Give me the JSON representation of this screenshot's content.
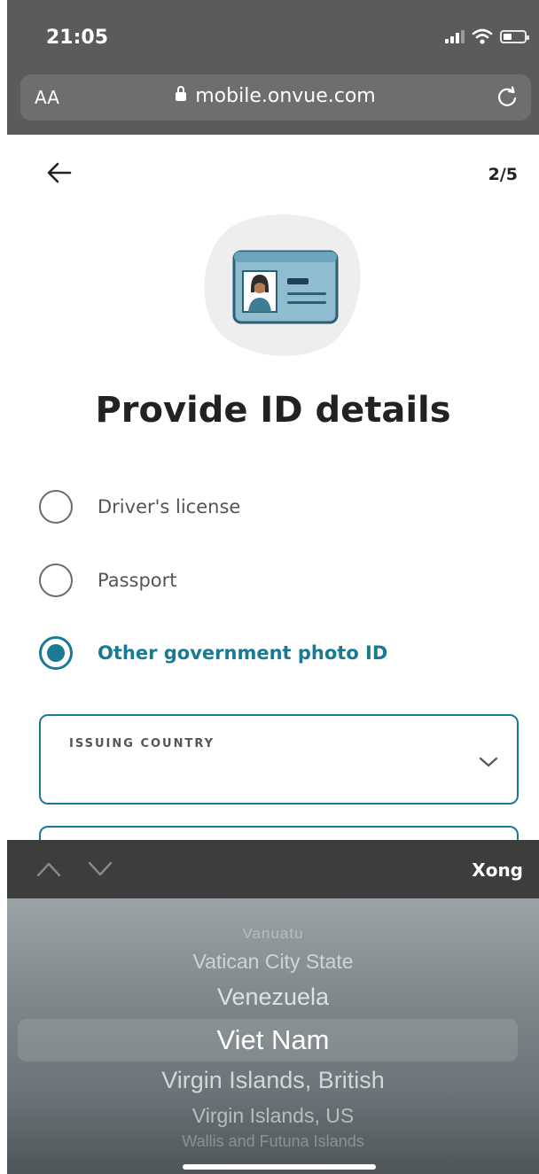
{
  "status_bar": {
    "time": "21:05"
  },
  "browser": {
    "text_size_label": "AA",
    "url": "mobile.onvue.com"
  },
  "header": {
    "step": "2/5"
  },
  "page": {
    "title": "Provide ID details"
  },
  "id_types": [
    {
      "label": "Driver's license",
      "selected": false
    },
    {
      "label": "Passport",
      "selected": false
    },
    {
      "label": "Other government photo ID",
      "selected": true
    }
  ],
  "issuing_country": {
    "label": "ISSUING COUNTRY",
    "value": ""
  },
  "picker": {
    "done_label": "Xong",
    "options": [
      "Vanuatu",
      "Vatican City State",
      "Venezuela",
      "Viet Nam",
      "Virgin Islands, British",
      "Virgin Islands, US",
      "Wallis and Futuna Islands"
    ],
    "selected": "Viet Nam"
  },
  "colors": {
    "accent": "#1a7a94",
    "browser_chrome": "#5b5b5b",
    "picker_toolbar": "#3d3d3d"
  }
}
